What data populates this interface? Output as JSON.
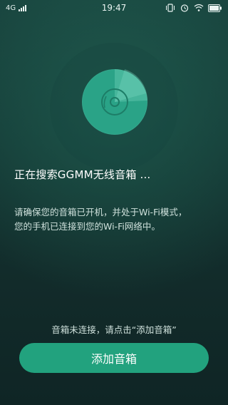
{
  "status_bar": {
    "network": "4G",
    "time": "19:47"
  },
  "search": {
    "title": "正在搜索GGMM无线音箱 ...",
    "description_lines": [
      "请确保您的音箱已开机，并处于Wi-Fi模式，",
      "您的手机已连接到您的Wi-Fi网络中。"
    ]
  },
  "footer": {
    "hint": "音箱未连接，请点击“添加音箱”",
    "add_button_label": "添加音箱"
  },
  "colors": {
    "accent": "#22a27e",
    "radar": "#2aa387",
    "background_top": "#18413c",
    "background_bottom": "#0f2525"
  }
}
